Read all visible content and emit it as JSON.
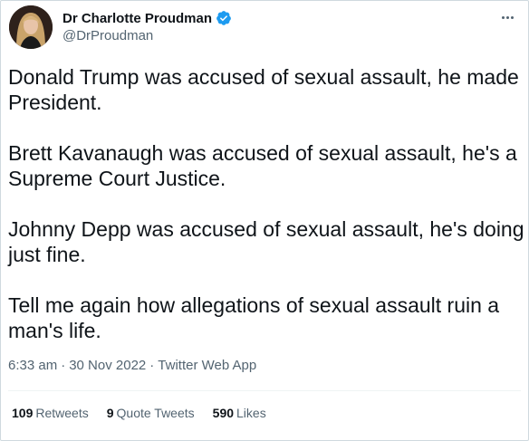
{
  "author": {
    "display_name": "Dr Charlotte Proudman",
    "handle": "@DrProudman",
    "verified_icon": "verified-badge-icon",
    "verified_color": "#1d9bf0"
  },
  "tweet": {
    "paragraphs": [
      "Donald Trump was accused of sexual assault, he made President.",
      "Brett Kavanaugh was accused of sexual assault, he's a Supreme Court Justice.",
      "Johnny Depp was accused of sexual assault, he's doing just fine.",
      "Tell me again how allegations of sexual assault ruin a man's life."
    ]
  },
  "meta": {
    "time": "6:33 am",
    "separator": "·",
    "date": "30 Nov 2022",
    "source": "Twitter Web App"
  },
  "stats": {
    "retweets_count": "109",
    "retweets_label": "Retweets",
    "quotes_count": "9",
    "quotes_label": "Quote Tweets",
    "likes_count": "590",
    "likes_label": "Likes"
  },
  "colors": {
    "text": "#0f1419",
    "secondary": "#536471",
    "border": "#cfd9de"
  }
}
